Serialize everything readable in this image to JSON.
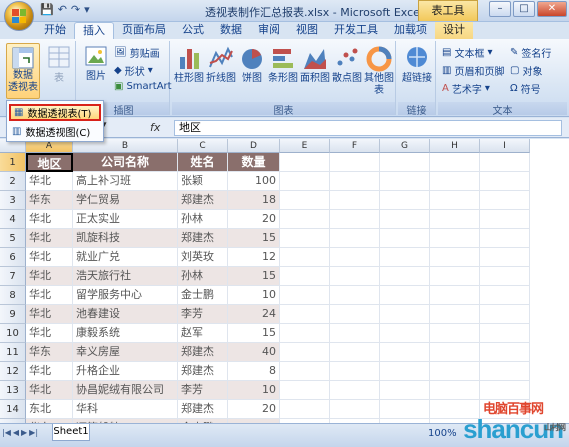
{
  "window": {
    "title": "透视表制作汇总报表.xlsx - Microsoft Excel",
    "context_tab": "表工具"
  },
  "tabs": [
    "开始",
    "插入",
    "页面布局",
    "公式",
    "数据",
    "审阅",
    "视图",
    "开发工具",
    "加载项",
    "设计"
  ],
  "ribbon": {
    "pivot_label_1": "数据",
    "pivot_label_2": "透视表",
    "table_label": "表",
    "picture_label": "图片",
    "clipart_label": "剪贴画",
    "shapes_label": "形状",
    "smartart_label": "SmartArt",
    "illustrations_group": "插图",
    "charts": [
      "柱形图",
      "折线图",
      "饼图",
      "条形图",
      "面积图",
      "散点图",
      "其他图表"
    ],
    "charts_group": "图表",
    "hyperlink_label": "超链接",
    "links_group": "链接",
    "textbox_label": "文本框",
    "header_footer_label": "页眉和页脚",
    "wordart_label": "艺术字",
    "signature_label": "签名行",
    "object_label": "对象",
    "symbol_label": "符号",
    "text_group": "文本"
  },
  "dropdown": {
    "items": [
      "数据透视表(T)",
      "数据透视图(C)"
    ]
  },
  "formula": {
    "fx": "fx",
    "value": "地区"
  },
  "sheet": {
    "columns": [
      "A",
      "B",
      "C",
      "D",
      "E",
      "F",
      "G",
      "H",
      "I"
    ],
    "headers": [
      "地区",
      "公司名称",
      "姓名",
      "数量"
    ],
    "rows": [
      [
        "华北",
        "高上补习班",
        "张颖",
        "100"
      ],
      [
        "华东",
        "学仁贸易",
        "郑建杰",
        "18"
      ],
      [
        "华北",
        "正太实业",
        "孙林",
        "20"
      ],
      [
        "华北",
        "凯旋科技",
        "郑建杰",
        "15"
      ],
      [
        "华北",
        "就业广兑",
        "刘英玫",
        "12"
      ],
      [
        "华北",
        "浩天旅行社",
        "孙林",
        "15"
      ],
      [
        "华北",
        "留学服务中心",
        "金士鹏",
        "10"
      ],
      [
        "华北",
        "池春建设",
        "李芳",
        "24"
      ],
      [
        "华北",
        "康毅系统",
        "赵军",
        "15"
      ],
      [
        "华东",
        "幸义房屋",
        "郑建杰",
        "40"
      ],
      [
        "华北",
        "升格企业",
        "郑建杰",
        "8"
      ],
      [
        "华北",
        "协昌妮绒有限公司",
        "李芳",
        "10"
      ],
      [
        "东北",
        "华科",
        "郑建杰",
        "20"
      ],
      [
        "华东",
        "迈策船舶",
        "金士鹏",
        "3"
      ],
      [
        "华北",
        "汉典电机",
        "孙林",
        "6"
      ]
    ],
    "sheet_tab": "Sheet1",
    "zoom": "100%"
  },
  "watermark": {
    "main": "shancun",
    "top": "电脑百事网",
    "sub": "山村网"
  }
}
